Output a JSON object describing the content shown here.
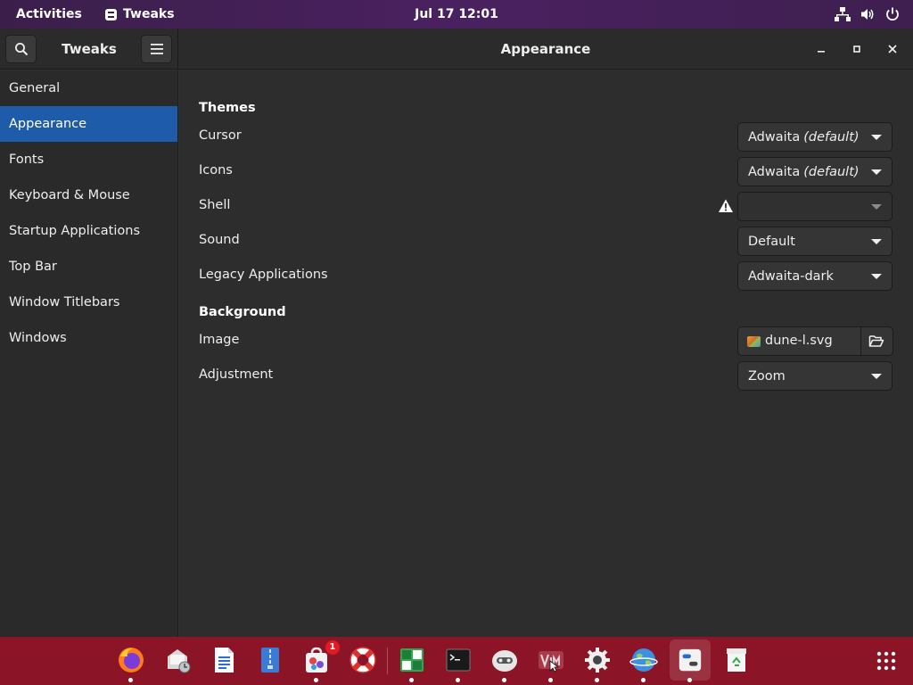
{
  "topbar": {
    "activities": "Activities",
    "app_name": "Tweaks",
    "clock": "Jul 17  12:01",
    "tray_icons": [
      "network-icon",
      "volume-icon",
      "power-icon"
    ]
  },
  "window": {
    "app_title": "Tweaks",
    "page_title": "Appearance",
    "controls": [
      "minimize-icon",
      "maximize-icon",
      "close-icon"
    ]
  },
  "sidebar": {
    "items": [
      {
        "label": "General",
        "active": false
      },
      {
        "label": "Appearance",
        "active": true
      },
      {
        "label": "Fonts",
        "active": false
      },
      {
        "label": "Keyboard & Mouse",
        "active": false
      },
      {
        "label": "Startup Applications",
        "active": false
      },
      {
        "label": "Top Bar",
        "active": false
      },
      {
        "label": "Window Titlebars",
        "active": false
      },
      {
        "label": "Windows",
        "active": false
      }
    ]
  },
  "themes": {
    "heading": "Themes",
    "cursor": {
      "label": "Cursor",
      "value": "Adwaita",
      "suffix": "(default)"
    },
    "icons": {
      "label": "Icons",
      "value": "Adwaita",
      "suffix": "(default)"
    },
    "shell": {
      "label": "Shell",
      "value": "",
      "disabled": true,
      "warning_icon": "warning-icon"
    },
    "sound": {
      "label": "Sound",
      "value": "Default"
    },
    "legacy": {
      "label": "Legacy Applications",
      "value": "Adwaita-dark"
    }
  },
  "background": {
    "heading": "Background",
    "image": {
      "label": "Image",
      "file": "dune-l.svg"
    },
    "adjustment": {
      "label": "Adjustment",
      "value": "Zoom"
    }
  },
  "dock": {
    "apps": [
      {
        "name": "firefox-icon"
      },
      {
        "name": "mail-client-icon"
      },
      {
        "name": "text-document-icon"
      },
      {
        "name": "archive-manager-icon"
      },
      {
        "name": "software-center-icon",
        "badge": "1"
      },
      {
        "name": "help-lifebuoy-icon"
      },
      {
        "name": "boxes-grid-icon"
      },
      {
        "name": "terminal-icon"
      },
      {
        "name": "robot-face-icon"
      },
      {
        "name": "vim-editor-icon"
      },
      {
        "name": "settings-gear-icon"
      },
      {
        "name": "web-browser-globe-icon"
      },
      {
        "name": "tweaks-icon",
        "focused": true
      },
      {
        "name": "trash-recycle-icon"
      }
    ],
    "show_apps_icon": "app-grid-icon"
  },
  "colors": {
    "accent": "#1e5ca9",
    "topbar": "#4a2160",
    "dock": "#8b1427",
    "badge": "#e01b24"
  }
}
